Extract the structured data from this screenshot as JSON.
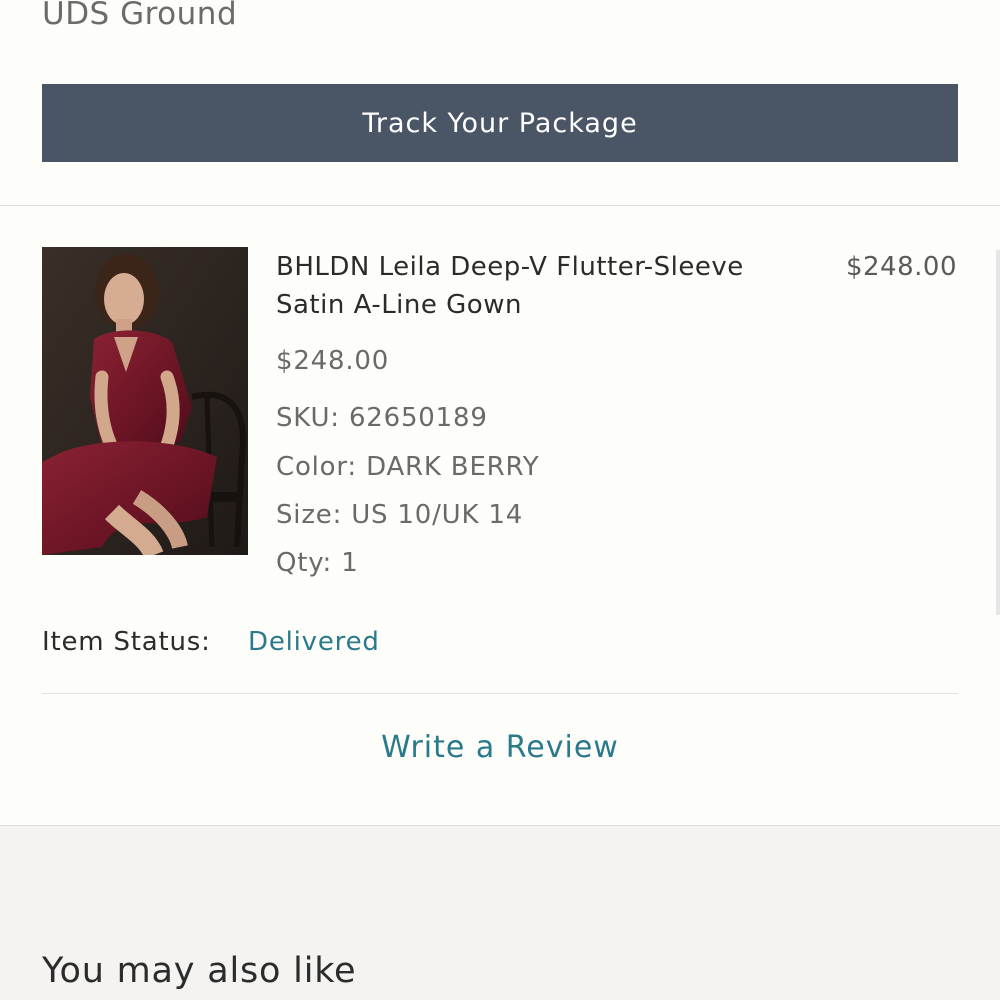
{
  "shipping": {
    "method": "UDS Ground"
  },
  "actions": {
    "track_package_label": "Track Your Package"
  },
  "item": {
    "name": "BHLDN Leila Deep-V Flutter-Sleeve Satin A-Line Gown",
    "line_total": "$248.00",
    "unit_price": "$248.00",
    "sku_label": "SKU:",
    "sku": "62650189",
    "color_label": "Color:",
    "color": "DARK BERRY",
    "size_label": "Size:",
    "size": "US 10/UK 14",
    "qty_label": "Qty:",
    "qty": "1",
    "image_icon": "product-photo"
  },
  "status": {
    "label": "Item Status:",
    "value": "Delivered"
  },
  "review": {
    "label": "Write a Review"
  },
  "recommendations": {
    "heading": "You may also like"
  },
  "colors": {
    "button_bg": "#4a5666",
    "accent": "#2a7a8c",
    "page_bg": "#fdfdfa",
    "lower_bg": "#f4f3f1"
  }
}
